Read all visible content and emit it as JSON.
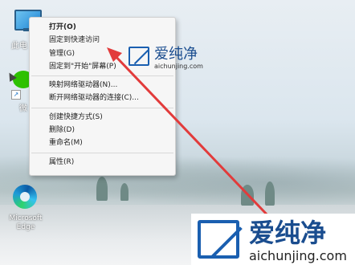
{
  "desktop": {
    "this_pc_label": "此电",
    "wechat_label": "微",
    "edge_label": "Microsoft Edge"
  },
  "context_menu": {
    "items": [
      {
        "label": "打开(O)",
        "bold": true
      },
      {
        "label": "固定到快速访问"
      },
      {
        "label": "管理(G)"
      },
      {
        "label": "固定到\"开始\"屏幕(P)"
      },
      {
        "separator": true
      },
      {
        "label": "映射网络驱动器(N)..."
      },
      {
        "label": "断开网络驱动器的连接(C)..."
      },
      {
        "separator": true
      },
      {
        "label": "创建快捷方式(S)"
      },
      {
        "label": "删除(D)"
      },
      {
        "label": "重命名(M)"
      },
      {
        "separator": true
      },
      {
        "label": "属性(R)"
      }
    ]
  },
  "watermark": {
    "title": "爱纯净",
    "url": "aichunjing.com"
  },
  "colors": {
    "arrow": "#e23b3b",
    "watermark_blue": "#1a5fb0"
  }
}
